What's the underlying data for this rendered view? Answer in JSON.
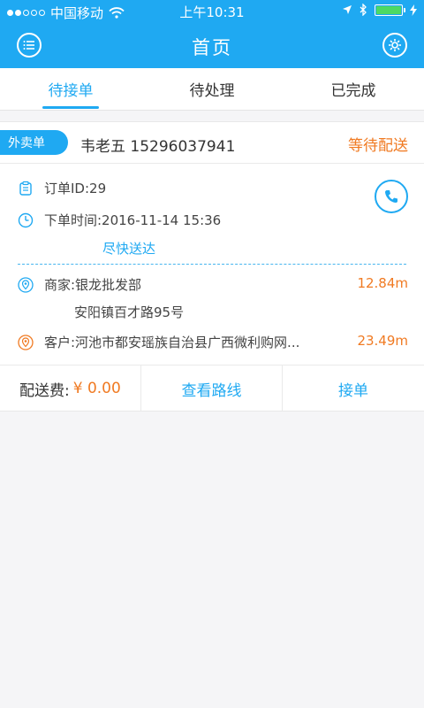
{
  "status_bar": {
    "carrier": "中国移动",
    "time": "上午10:31"
  },
  "nav": {
    "title": "首页"
  },
  "tabs": [
    {
      "label": "待接单",
      "active": true
    },
    {
      "label": "待处理",
      "active": false
    },
    {
      "label": "已完成",
      "active": false
    }
  ],
  "order": {
    "type_tag": "外卖单",
    "contact": "韦老五 15296037941",
    "status": "等待配送",
    "order_id": "订单ID:29",
    "order_time": "下单时间:2016-11-14 15:36",
    "delivery_note": "尽快送达",
    "merchant": "商家:银龙批发部",
    "merchant_distance": "12.84m",
    "merchant_address": "安阳镇百才路95号",
    "customer": "客户:河池市都安瑶族自治县广西微利购网...",
    "customer_distance": "23.49m",
    "fee_label": "配送费:",
    "fee_value": "¥ 0.00",
    "route_button": "查看路线",
    "accept_button": "接单"
  },
  "colors": {
    "accent": "#1fa9f2",
    "warning": "#f07a22"
  }
}
